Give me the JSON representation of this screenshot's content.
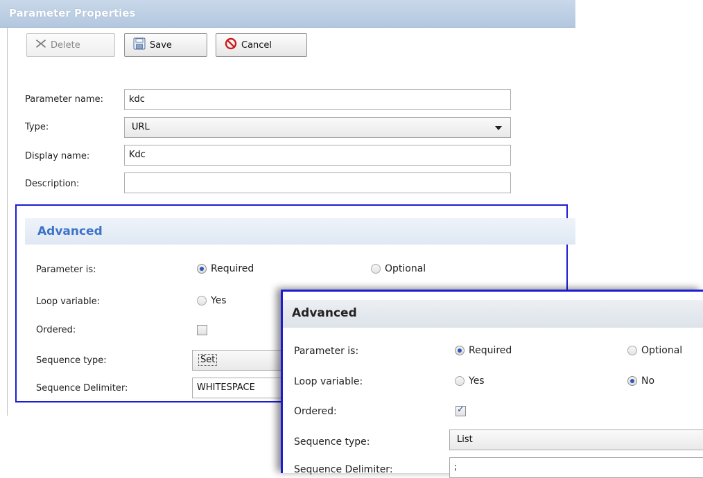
{
  "window": {
    "title": "Parameter Properties"
  },
  "toolbar": {
    "delete_label": "Delete",
    "save_label": "Save",
    "cancel_label": "Cancel"
  },
  "form": {
    "parameter_name_label": "Parameter name:",
    "parameter_name_value": "kdc",
    "type_label": "Type:",
    "type_value": "URL",
    "display_name_label": "Display name:",
    "display_name_value": "Kdc",
    "description_label": "Description:",
    "description_value": ""
  },
  "advanced_main": {
    "title": "Advanced",
    "parameter_is_label": "Parameter is:",
    "required_label": "Required",
    "optional_label": "Optional",
    "loop_variable_label": "Loop variable:",
    "yes_label": "Yes",
    "ordered_label": "Ordered:",
    "sequence_type_label": "Sequence type:",
    "sequence_type_value": "Set",
    "sequence_delimiter_label": "Sequence Delimiter:",
    "sequence_delimiter_value": "WHITESPACE"
  },
  "advanced_zoom": {
    "title": "Advanced",
    "parameter_is_label": "Parameter is:",
    "required_label": "Required",
    "optional_label": "Optional",
    "loop_variable_label": "Loop variable:",
    "yes_label": "Yes",
    "no_label": "No",
    "ordered_label": "Ordered:",
    "sequence_type_label": "Sequence type:",
    "sequence_type_value": "List",
    "sequence_delimiter_label": "Sequence Delimiter:",
    "sequence_delimiter_value": ";"
  },
  "state": {
    "main_required_selected": true,
    "main_ordered_checked": false,
    "zoom_required_selected": true,
    "zoom_loop_no_selected": true,
    "zoom_ordered_checked": true
  },
  "colors": {
    "titlebar": "#b9cde3",
    "highlight_frame": "#1c1cd6",
    "advanced_header_text": "#3d73c9"
  },
  "icons": {
    "delete": "x-icon",
    "save": "floppy-disk-icon",
    "cancel": "no-entry-icon",
    "dropdown": "chevron-down-icon"
  }
}
